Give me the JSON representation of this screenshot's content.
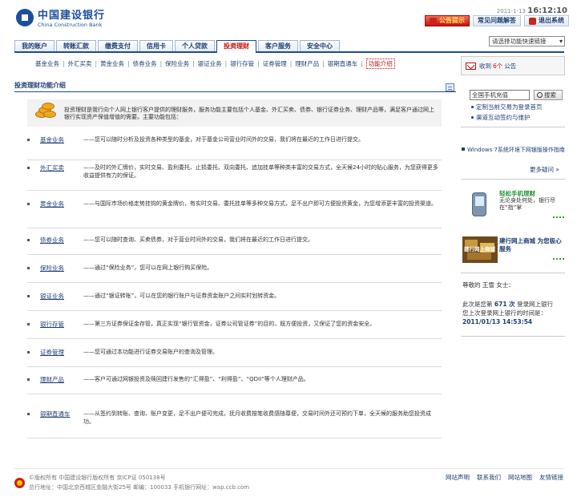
{
  "header": {
    "logo_cn": "中国建设银行",
    "logo_en": "China Construction Bank",
    "date": "2011-1-13",
    "time": "16:12:10",
    "buttons": [
      "公告提示",
      "常见问题解答",
      "退出系统"
    ]
  },
  "nav": {
    "tabs": [
      "我的账户",
      "转账汇款",
      "缴费支付",
      "信用卡",
      "个人贷款",
      "投资理财",
      "客户服务",
      "安全中心"
    ],
    "active_index": 5,
    "quick_select": "请选择功能快速链接"
  },
  "subnav": {
    "items": [
      "基金业务",
      "外汇买卖",
      "黄金业务",
      "债券业务",
      "保险业务",
      "银证业务",
      "银行存管",
      "证券管理",
      "理财产品",
      "银期直通车",
      "功能介绍"
    ],
    "active_index": 10
  },
  "notice": {
    "prefix": "收到",
    "count": "6个",
    "suffix": "公告"
  },
  "section_title": "投资理财功能介绍",
  "intro": "投资理财是我行向个人网上银行客户提供的理财服务，服务功能主要包括个人基金、外汇买卖、债券、银行证券业务、理财产品等，满足客户通过网上银行实现资产保值增值的需要。主要功能包括：",
  "services": [
    {
      "name": "基金业务",
      "desc": "——您可以随时分析及投资各种类型的基金，对于基金公司营业时间外的交易，我们将在最近的工作日进行提交。"
    },
    {
      "name": "外汇买卖",
      "desc": "——及时的外汇牌价，实时交易、盈利委托、止损委托、双向委托、追加挂单等种类丰富的交易方式，全天候24小时的贴心服务，为您获得更多收益提供有力的保证。"
    },
    {
      "name": "黄金业务",
      "desc": "——与国际市场价格走势挂钩的黄金牌价，有实时交易、委托挂单等多种交易方式，足不出户即可方便投资黄金，为您增添更丰富的投资渠道。"
    },
    {
      "name": "债券业务",
      "desc": "——您可以随时查询、买卖债券，对于营业时间外的交易，我们将在最近的工作日进行提交。"
    },
    {
      "name": "保险业务",
      "desc": "——通过“保险业务”，您可以在网上银行购买保险。"
    },
    {
      "name": "银证业务",
      "desc": "——通过“银证转账”，可以在您的银行账户与证券资金账户之间实时划转资金。"
    },
    {
      "name": "银行存管",
      "desc": "——第三方证券保证金存管，真正实现“银行管资金，证券公司管证券”的目的，既方便投资，又保证了您的资金安全。"
    },
    {
      "name": "证券管理",
      "desc": "——您可通过本功能进行证券交易账户的查询及管理。"
    },
    {
      "name": "理财产品",
      "desc": "——客户可通过网银投资及赎回建行发售的“汇得盈”、“利得盈”、“QDII”等个人理财产品。"
    },
    {
      "name": "银期直通车",
      "desc": "——从签约到转账、查询、账户变更，足不出户便可完成，抚月收费按笔收费感随尊便，交易时间外还可预约下单，全天候的服务助您投资成功。"
    }
  ],
  "right": {
    "search_value": "全国手机充值",
    "search_button": "搜索",
    "links": [
      "定制当前交易为登录首页",
      "渠道互动签约与维护"
    ],
    "news": "Windows 7系统环境下网银版操作指南",
    "more": "更多疑问",
    "promo1": {
      "title": "轻松手机理财",
      "desc": "无论身处何处，银行尽在“指”掌"
    },
    "promo2": {
      "title": "建行网上商城 为您极心服务",
      "image_text": "建行网上商城"
    },
    "welcome": "尊敬的 王雪 女士：",
    "login_prefix": "此次是您第",
    "login_count": "671 次",
    "login_suffix": "登录网上银行",
    "last_login_label": "您上次登录网上银行的时间是：",
    "last_login_time": "2011/01/13 14:53:54"
  },
  "footer": {
    "copyright": "©版权所有 中国建设银行版权所有 京ICP证 050138号",
    "address": "总行地址：中国北京西城区金融大街25号 邮编：100033 手机银行网址：wap.ccb.com",
    "links": [
      "网站声明",
      "联系我们",
      "网站地图",
      "友情链接"
    ]
  }
}
